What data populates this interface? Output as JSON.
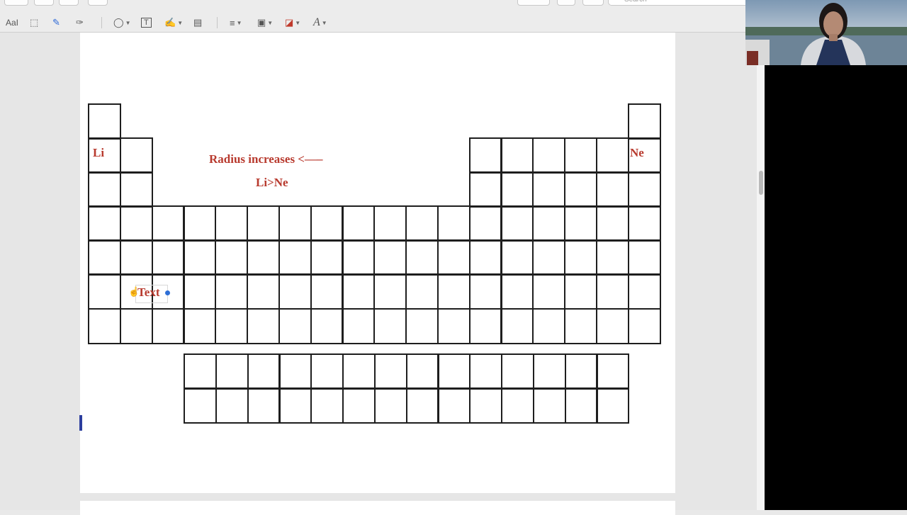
{
  "toolbar": {
    "search_placeholder": "Search",
    "tools": [
      {
        "name": "text-style",
        "glyph": "AaI"
      },
      {
        "name": "rectangular-selection",
        "glyph": "⬚"
      },
      {
        "name": "sketch",
        "glyph": "✎"
      },
      {
        "name": "draw",
        "glyph": "✑"
      },
      {
        "name": "shapes",
        "glyph": "◯"
      },
      {
        "name": "text-box",
        "glyph": "T"
      },
      {
        "name": "sign",
        "glyph": "✍"
      },
      {
        "name": "note",
        "glyph": "▤"
      },
      {
        "name": "shape-style",
        "glyph": "≡"
      },
      {
        "name": "border-color",
        "glyph": "▣"
      },
      {
        "name": "fill-color",
        "glyph": "◪"
      },
      {
        "name": "text-style-format",
        "glyph": "A"
      }
    ]
  },
  "document": {
    "annotations": {
      "li_label": "Li",
      "ne_label": "Ne",
      "radius_note": "Radius increases <—–",
      "comparison": "Li>Ne",
      "textbox_placeholder": "Text"
    }
  },
  "colors": {
    "annotation": "#b83a2e",
    "grid_line": "#1e1e1e",
    "selection_handle": "#2e6fd6"
  }
}
